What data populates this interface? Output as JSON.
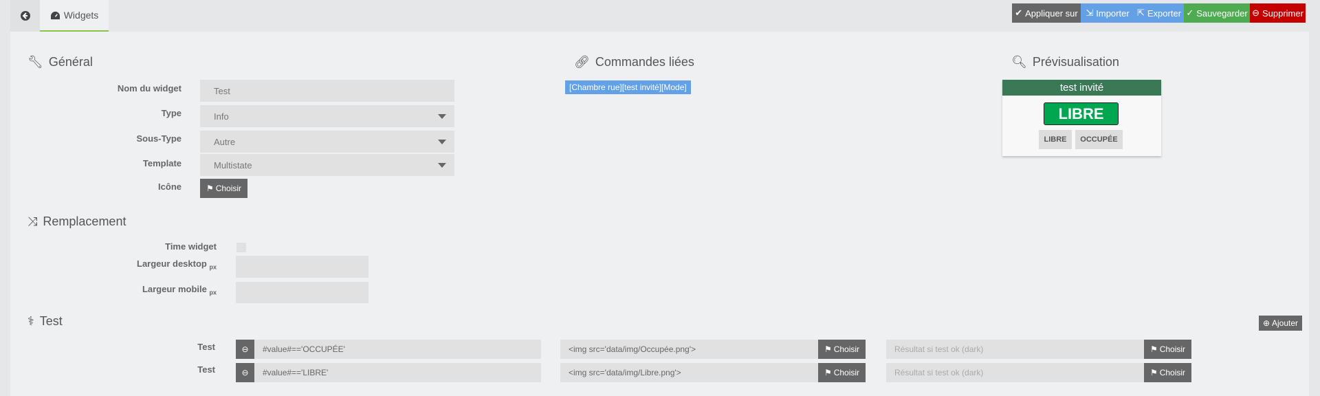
{
  "tabs": {
    "back": "back",
    "widgets": "Widgets"
  },
  "toolbar": {
    "apply": "Appliquer sur",
    "import": "Importer",
    "export": "Exporter",
    "save": "Sauvegarder",
    "delete": "Supprimer"
  },
  "colors": {
    "apply": "#666666",
    "import": "#64a0e6",
    "export": "#64a0e6",
    "save": "#4fab52",
    "delete": "#c40000",
    "widget_header": "#3a7856",
    "widget_state": "#00a650"
  },
  "general": {
    "title": "Général",
    "name_label": "Nom du widget",
    "name_value": "Test",
    "type_label": "Type",
    "type_value": "Info",
    "subtype_label": "Sous-Type",
    "subtype_value": "Autre",
    "template_label": "Template",
    "template_value": "Multistate",
    "icon_label": "Icône",
    "choose": "Choisir"
  },
  "commands": {
    "title": "Commandes liées",
    "tag": "[Chambre rue][test invité][Mode]"
  },
  "preview": {
    "title": "Prévisualisation",
    "widget_name": "test invité",
    "state": "LIBRE",
    "options": [
      "LIBRE",
      "OCCUPÉE"
    ]
  },
  "replacement": {
    "title": "Remplacement",
    "time_widget": "Time widget",
    "desktop_width": "Largeur desktop",
    "mobile_width": "Largeur mobile",
    "unit": "px"
  },
  "test": {
    "title": "Test",
    "add": "Ajouter",
    "rows": [
      {
        "label": "Test",
        "condition": "#value#=='OCCUPÉE'",
        "result": "<img src='data/img/Occupée.png'>",
        "dark_placeholder": "Résultat si test ok (dark)",
        "choose": "Choisir"
      },
      {
        "label": "Test",
        "condition": "#value#=='LIBRE'",
        "result": "<img src='data/img/Libre.png'>",
        "dark_placeholder": "Résultat si test ok (dark)",
        "choose": "Choisir"
      }
    ]
  }
}
